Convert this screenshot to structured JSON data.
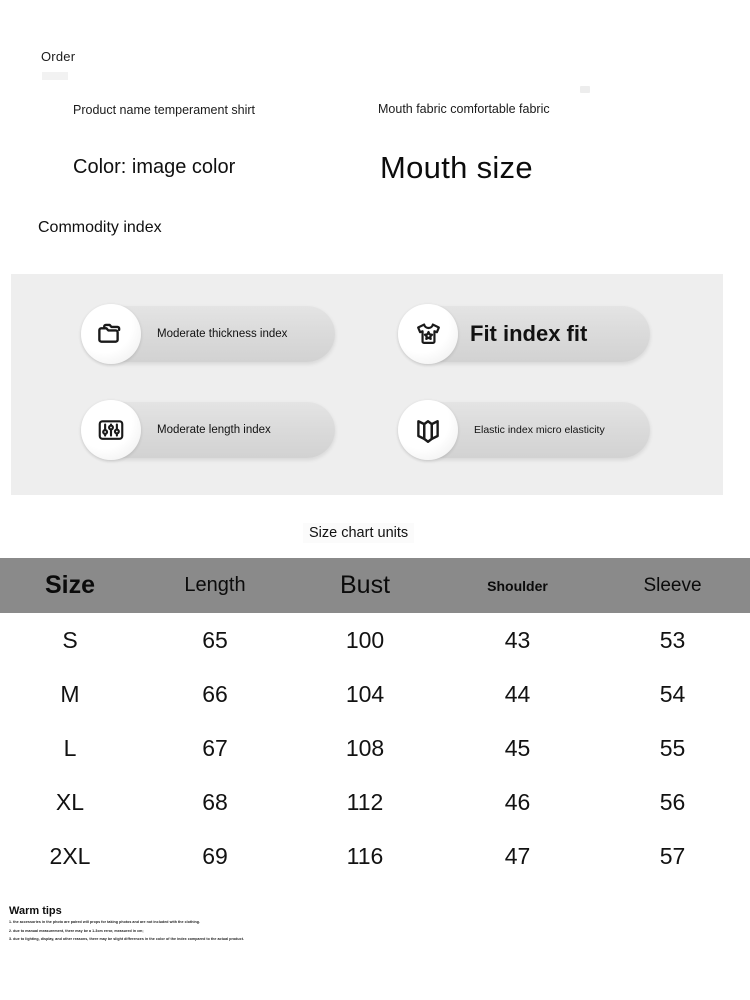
{
  "header": {
    "order_label": "Order",
    "product_name": "Product name temperament shirt",
    "fabric_name": "Mouth fabric comfortable fabric",
    "color_line": "Color: image color",
    "mouth_size": "Mouth size",
    "commodity_index": "Commodity index"
  },
  "index_panel": {
    "pills": [
      {
        "icon": "folder-icon",
        "label": "Moderate thickness index"
      },
      {
        "icon": "sliders-icon",
        "label": "Moderate length index"
      },
      {
        "icon": "tshirt-icon",
        "label": "Fit index fit"
      },
      {
        "icon": "map-icon",
        "label": "Elastic index micro elasticity"
      }
    ]
  },
  "size_chart": {
    "units_label": "Size chart units",
    "columns": [
      "Size",
      "Length",
      "Bust",
      "Shoulder",
      "Sleeve"
    ],
    "rows": [
      [
        "S",
        "65",
        "100",
        "43",
        "53"
      ],
      [
        "M",
        "66",
        "104",
        "44",
        "54"
      ],
      [
        "L",
        "67",
        "108",
        "45",
        "55"
      ],
      [
        "XL",
        "68",
        "112",
        "46",
        "56"
      ],
      [
        "2XL",
        "69",
        "116",
        "47",
        "57"
      ]
    ]
  },
  "warm_tips": {
    "title": "Warm tips",
    "lines": [
      "1. the accessories in the photo are paired will props for taking photos and are not included with the clothing.",
      "2. due to manual measurement, there may be a 1-3cm error, measured in cm;",
      "3. due to lighting, display, and other reasons, there may be slight differences in the color of the index compared to the actual product."
    ]
  },
  "colors": {
    "panel_bg": "#eeeeee",
    "table_header_bg": "#8a8a8a",
    "pill_bg": "#dbdbdb",
    "text": "#111111"
  },
  "chart_data": {
    "type": "table",
    "title": "Size chart units",
    "columns": [
      "Size",
      "Length",
      "Bust",
      "Shoulder",
      "Sleeve"
    ],
    "rows": [
      {
        "Size": "S",
        "Length": 65,
        "Bust": 100,
        "Shoulder": 43,
        "Sleeve": 53
      },
      {
        "Size": "M",
        "Length": 66,
        "Bust": 104,
        "Shoulder": 44,
        "Sleeve": 54
      },
      {
        "Size": "L",
        "Length": 67,
        "Bust": 108,
        "Shoulder": 45,
        "Sleeve": 55
      },
      {
        "Size": "XL",
        "Length": 68,
        "Bust": 112,
        "Shoulder": 46,
        "Sleeve": 56
      },
      {
        "Size": "2XL",
        "Length": 69,
        "Bust": 116,
        "Shoulder": 47,
        "Sleeve": 57
      }
    ],
    "units": "cm"
  }
}
